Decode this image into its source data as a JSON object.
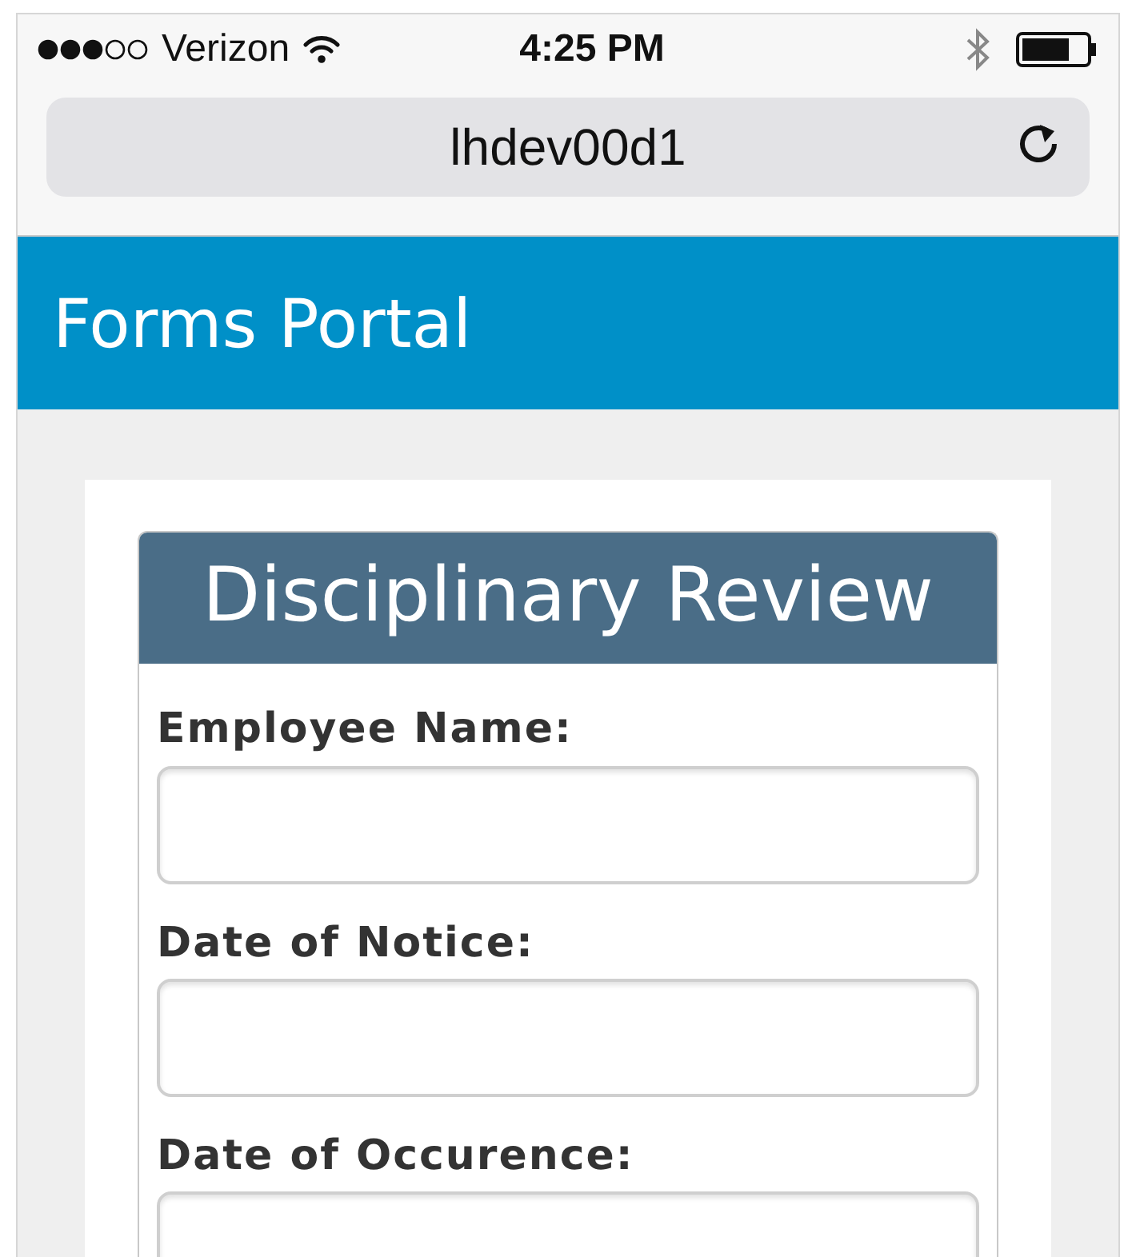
{
  "status_bar": {
    "carrier": "Verizon",
    "time": "4:25 PM"
  },
  "address_bar": {
    "url": "lhdev00d1"
  },
  "header": {
    "title": "Forms Portal"
  },
  "form": {
    "title": "Disciplinary Review",
    "fields": [
      {
        "label": "Employee Name:"
      },
      {
        "label": "Date of Notice:"
      },
      {
        "label": "Date of Occurence:"
      }
    ]
  }
}
